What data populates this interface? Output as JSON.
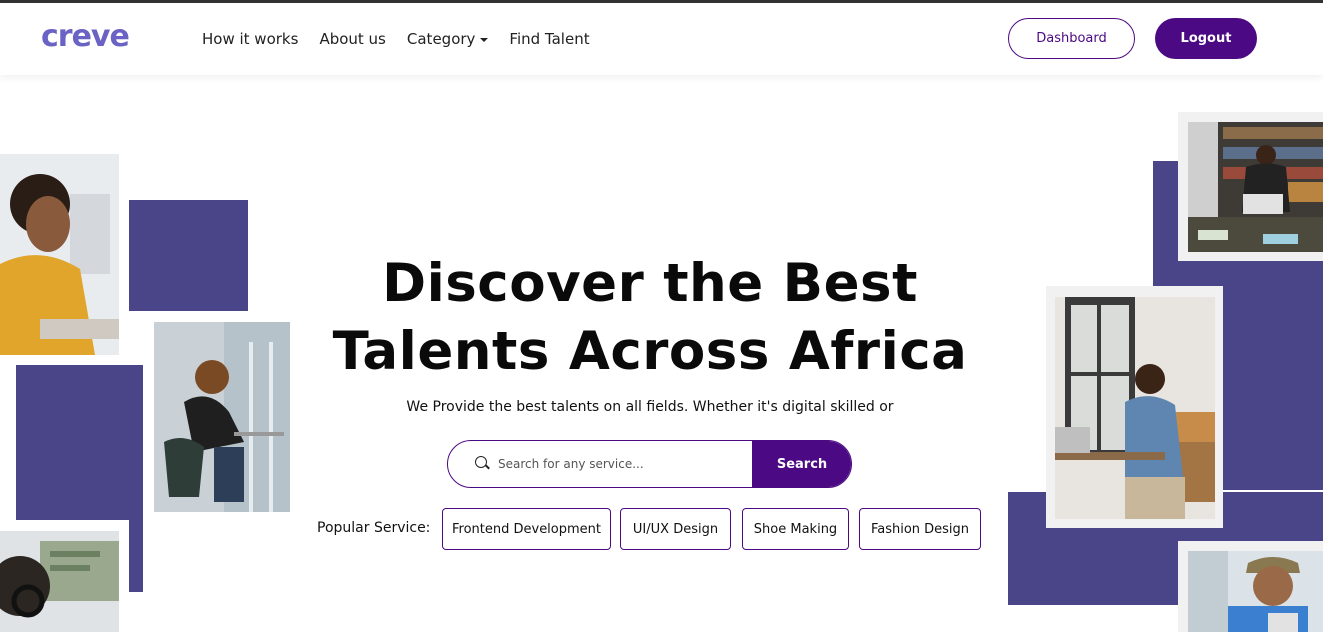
{
  "brand": {
    "logo_text": "creve",
    "accent": "#4b0a84",
    "logo_color": "#6b63c4",
    "block_color": "#4a4489"
  },
  "nav": {
    "links": [
      {
        "label": "How it works"
      },
      {
        "label": "About us"
      },
      {
        "label": "Category"
      },
      {
        "label": "Find Talent"
      }
    ],
    "dashboard_label": "Dashboard",
    "logout_label": "Logout"
  },
  "hero": {
    "title_line1": "Discover the Best",
    "title_line2": "Talents Across Africa",
    "subtitle": "We Provide the best talents on all fields. Whether it's digital skilled or"
  },
  "search": {
    "placeholder": "Search for any service...",
    "button_label": "Search"
  },
  "popular": {
    "label": "Popular Service:",
    "chips": [
      {
        "label": "Frontend Development"
      },
      {
        "label": "UI/UX Design"
      },
      {
        "label": "Shoe Making"
      },
      {
        "label": "Fashion Design"
      }
    ]
  }
}
